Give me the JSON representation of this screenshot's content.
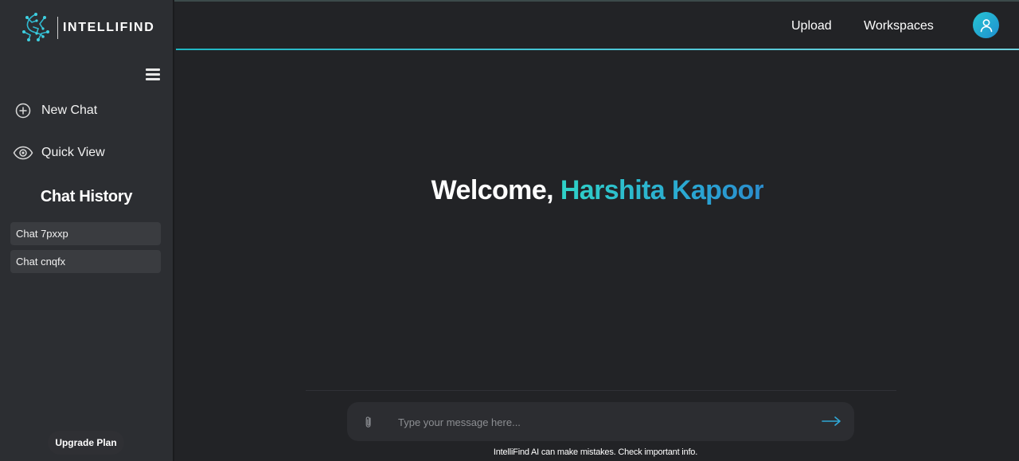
{
  "brand": {
    "name": "INTELLIFIND"
  },
  "sidebar": {
    "menu_icon": "hamburger-icon",
    "nav": [
      {
        "label": "New Chat",
        "icon": "plus-circle-icon"
      },
      {
        "label": "Quick View",
        "icon": "eye-icon"
      }
    ],
    "history_title": "Chat History",
    "history": [
      {
        "label": "Chat 7pxxp"
      },
      {
        "label": "Chat cnqfx"
      }
    ],
    "upgrade_label": "Upgrade Plan"
  },
  "header": {
    "links": [
      {
        "label": "Upload"
      },
      {
        "label": "Workspaces"
      }
    ],
    "avatar_icon": "user-icon"
  },
  "main": {
    "welcome_prefix": "Welcome, ",
    "user_name": "Harshita Kapoor"
  },
  "composer": {
    "placeholder": "Type your message here...",
    "attach_icon": "paperclip-icon",
    "send_icon": "arrow-right-icon",
    "disclaimer": "IntelliFind AI can make mistakes. Check important info."
  },
  "colors": {
    "accent": "#2fc0cf",
    "background": "#222326",
    "sidebar": "#2c2e32"
  }
}
